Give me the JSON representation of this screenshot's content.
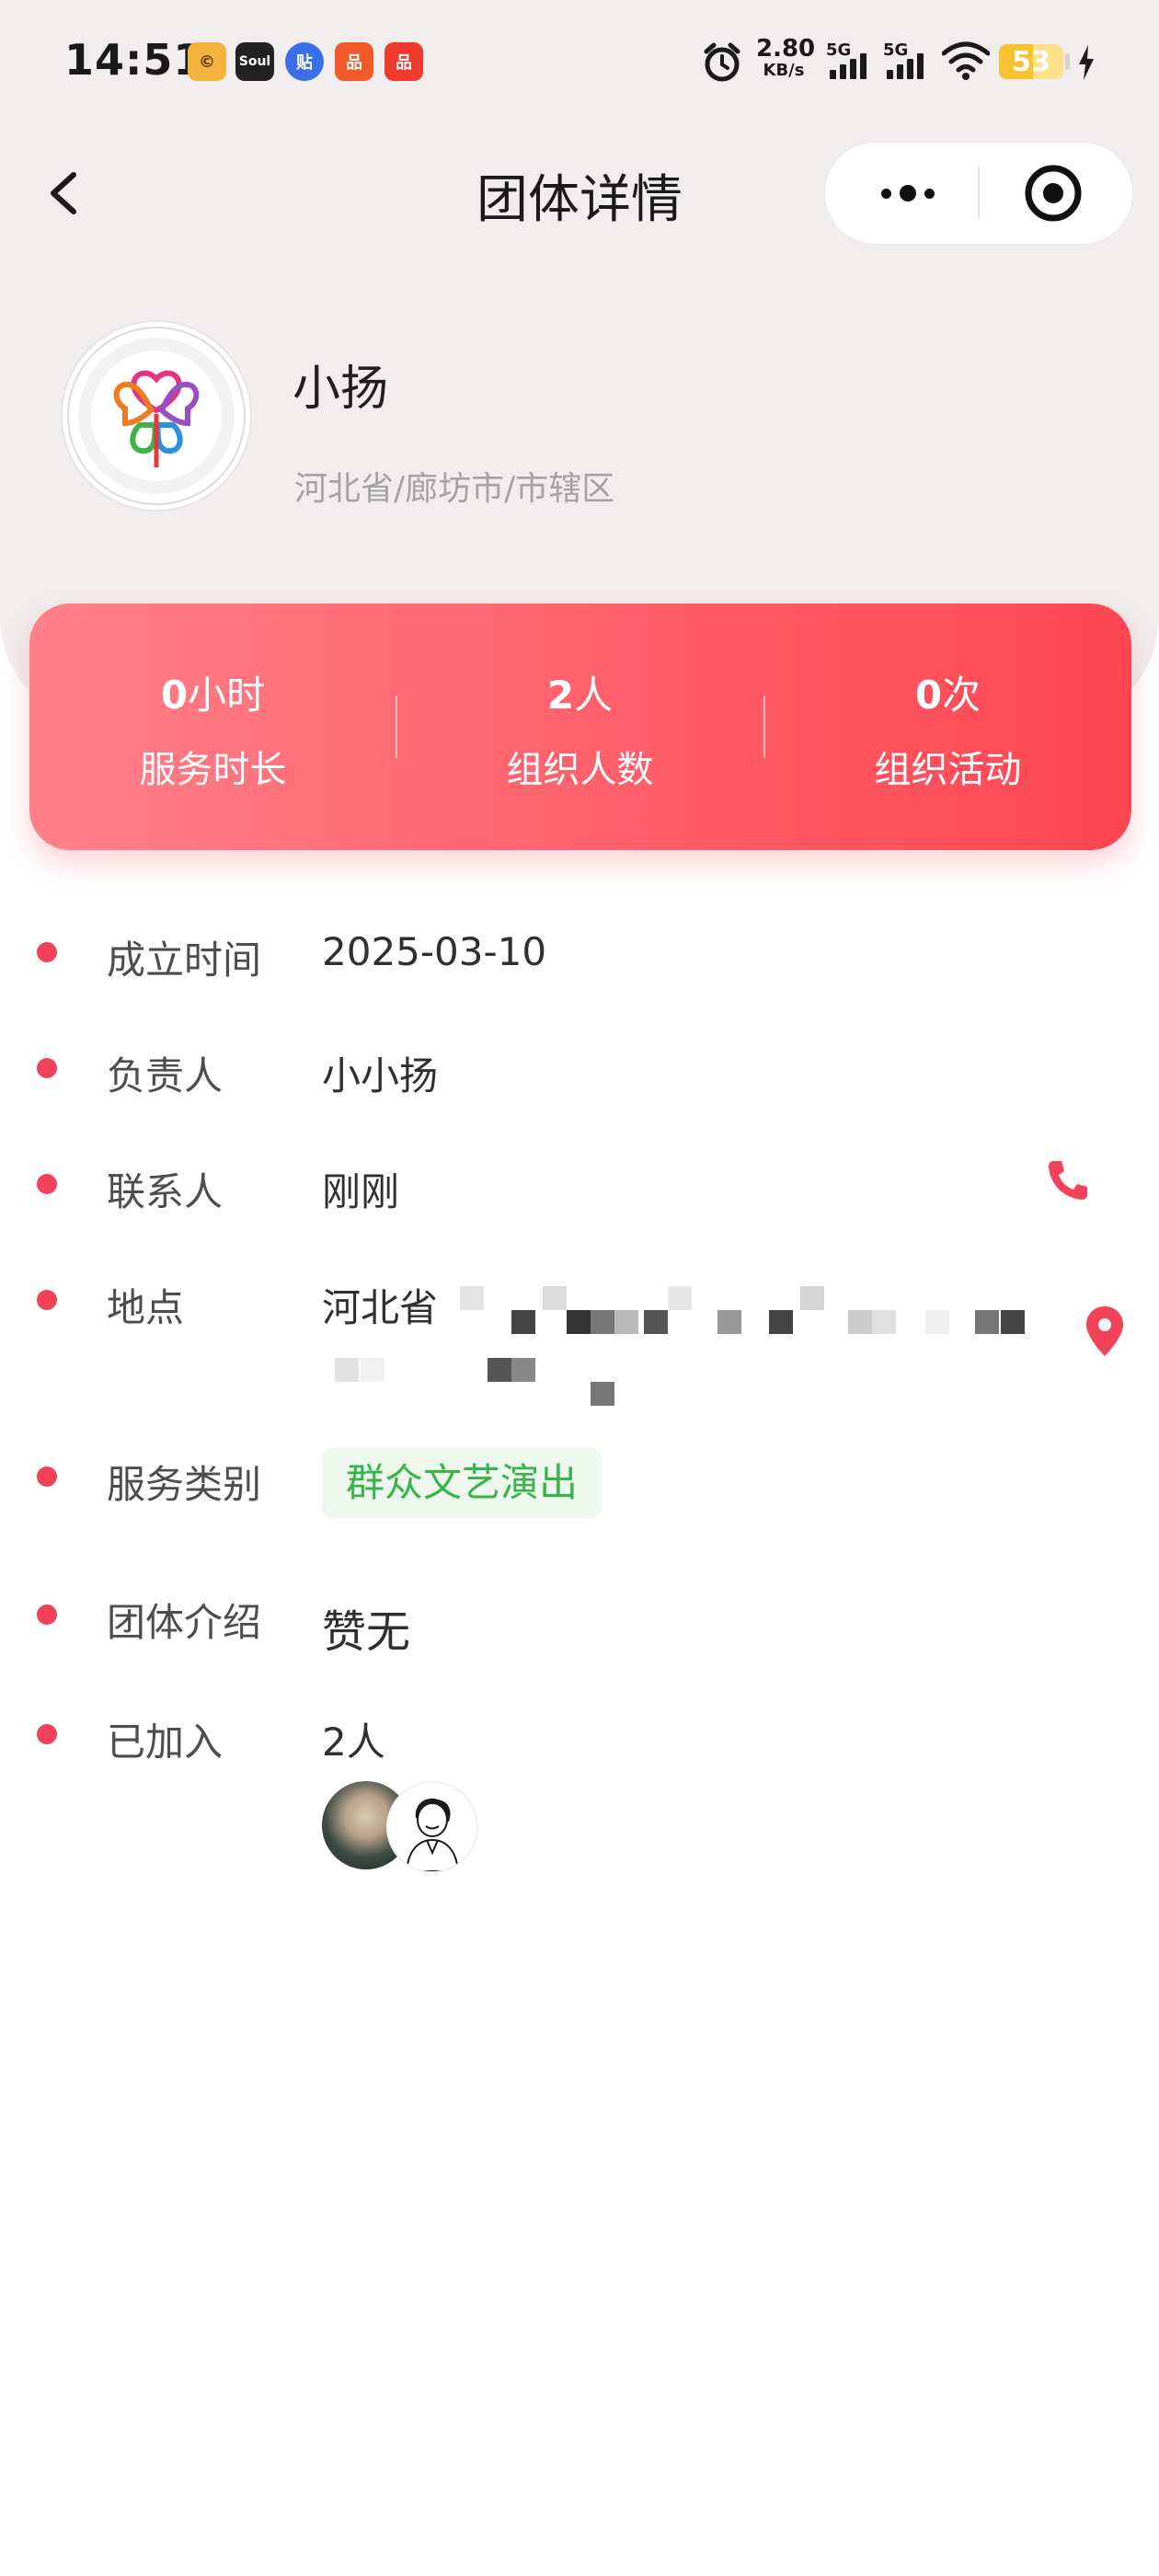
{
  "status_bar": {
    "time": "14:51",
    "apps": [
      "©",
      "Soul",
      "贴",
      "品",
      "品"
    ],
    "network_speed": "2.80",
    "network_speed_unit": "KB/s",
    "signal_1_label": "5G",
    "signal_2_label": "5G",
    "battery_level": "53"
  },
  "nav": {
    "title": "团体详情",
    "back_icon": "chevron-left-icon",
    "more_icon": "more-dots-icon",
    "close_icon": "target-close-icon"
  },
  "profile": {
    "logo_icon": "china-culture-tourism-volunteer-logo",
    "name": "小扬",
    "region": "河北省/廊坊市/市辖区"
  },
  "stats": [
    {
      "value": "0",
      "unit": "小时",
      "label": "服务时长"
    },
    {
      "value": "2",
      "unit": "人",
      "label": "组织人数"
    },
    {
      "value": "0",
      "unit": "次",
      "label": "组织活动"
    }
  ],
  "details": {
    "founded_label": "成立时间",
    "founded_value": "2025-03-10",
    "leader_label": "负责人",
    "leader_value": "小小扬",
    "contact_label": "联系人",
    "contact_value": "刚刚",
    "location_label": "地点",
    "location_value": "河北省",
    "category_label": "服务类别",
    "category_value": "群众文艺演出",
    "intro_label": "团体介绍",
    "intro_value": "赞无",
    "joined_label": "已加入",
    "joined_value": "2人"
  },
  "colors": {
    "accent": "#f0435a",
    "stats_gradient_start": "#ff8089",
    "stats_gradient_end": "#fd4652",
    "tag_text": "#38b54a",
    "tag_bg": "#eef8ee",
    "header_bg": "#f1eded"
  }
}
